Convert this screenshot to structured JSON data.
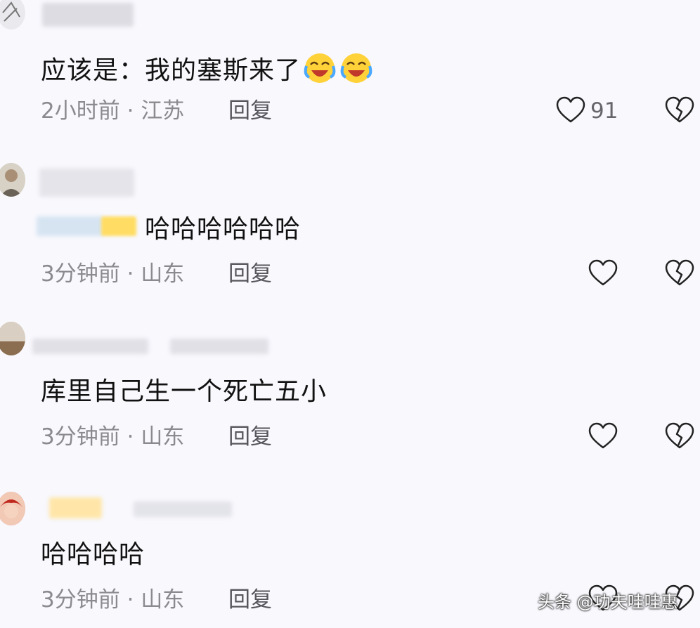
{
  "comments": [
    {
      "text": "应该是：我的塞斯来了",
      "emojis": [
        "laughing-crying-emoji",
        "laughing-crying-emoji"
      ],
      "time": "2小时前",
      "sep": "·",
      "location": "江苏",
      "reply_label": "回复",
      "like_count": "91"
    },
    {
      "text": "哈哈哈哈哈哈",
      "time": "3分钟前",
      "sep": "·",
      "location": "山东",
      "reply_label": "回复"
    },
    {
      "text": "库里自己生一个死亡五小",
      "time": "3分钟前",
      "sep": "·",
      "location": "山东",
      "reply_label": "回复"
    },
    {
      "text": "哈哈哈哈",
      "time": "3分钟前",
      "sep": "·",
      "location": "山东",
      "reply_label": "回复"
    }
  ],
  "watermark": "头条 @功夫哇哇惠",
  "colors": {
    "background": "#f8f8fd",
    "meta": "#8a8a8f",
    "icon": "#222222"
  },
  "icons": [
    "heart-outline-icon",
    "broken-heart-icon",
    "laughing-crying-emoji"
  ]
}
